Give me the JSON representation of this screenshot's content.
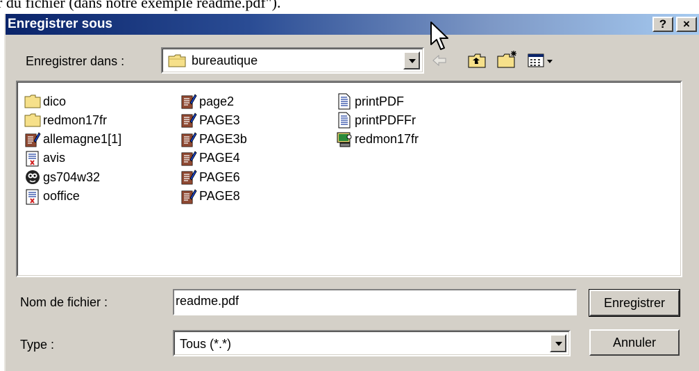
{
  "page": {
    "header_text": "r du fichier (dans notre exemple readme.pdf\")."
  },
  "window": {
    "title": "Enregistrer sous",
    "help_button": "?",
    "close_button": "×"
  },
  "save_in": {
    "label": "Enregistrer dans :",
    "value": "bureautique",
    "folder_icon": "folder-icon"
  },
  "toolbar": {
    "back_icon": "back-arrow-icon",
    "up_icon": "up-folder-icon",
    "new_folder_icon": "new-folder-icon",
    "view_menu_icon": "view-menu-icon"
  },
  "files": {
    "col1": [
      {
        "name": "dico",
        "icon": "folder"
      },
      {
        "name": "redmon17fr",
        "icon": "folder"
      },
      {
        "name": "allemagne1[1]",
        "icon": "word-doc"
      },
      {
        "name": "avis",
        "icon": "pdf-doc"
      },
      {
        "name": "gs704w32",
        "icon": "ghostscript"
      },
      {
        "name": "ooffice",
        "icon": "pdf-doc"
      }
    ],
    "col2": [
      {
        "name": "page2",
        "icon": "word-doc"
      },
      {
        "name": "PAGE3",
        "icon": "word-doc"
      },
      {
        "name": "PAGE3b",
        "icon": "word-doc"
      },
      {
        "name": "PAGE4",
        "icon": "word-doc"
      },
      {
        "name": "PAGE6",
        "icon": "word-doc"
      },
      {
        "name": "PAGE8",
        "icon": "word-doc"
      }
    ],
    "col3": [
      {
        "name": "printPDF",
        "icon": "text-doc"
      },
      {
        "name": "printPDFFr",
        "icon": "text-doc"
      },
      {
        "name": "redmon17fr",
        "icon": "setup"
      }
    ]
  },
  "filename": {
    "label": "Nom de fichier :",
    "value": "readme.pdf"
  },
  "filetype": {
    "label": "Type :",
    "value": "Tous (*.*)"
  },
  "buttons": {
    "save": "Enregistrer",
    "cancel": "Annuler"
  },
  "colors": {
    "titlebar_start": "#0a246a",
    "titlebar_end": "#a6caf0",
    "dialog_face": "#d4d0c8",
    "folder_yellow": "#f6e08a"
  }
}
